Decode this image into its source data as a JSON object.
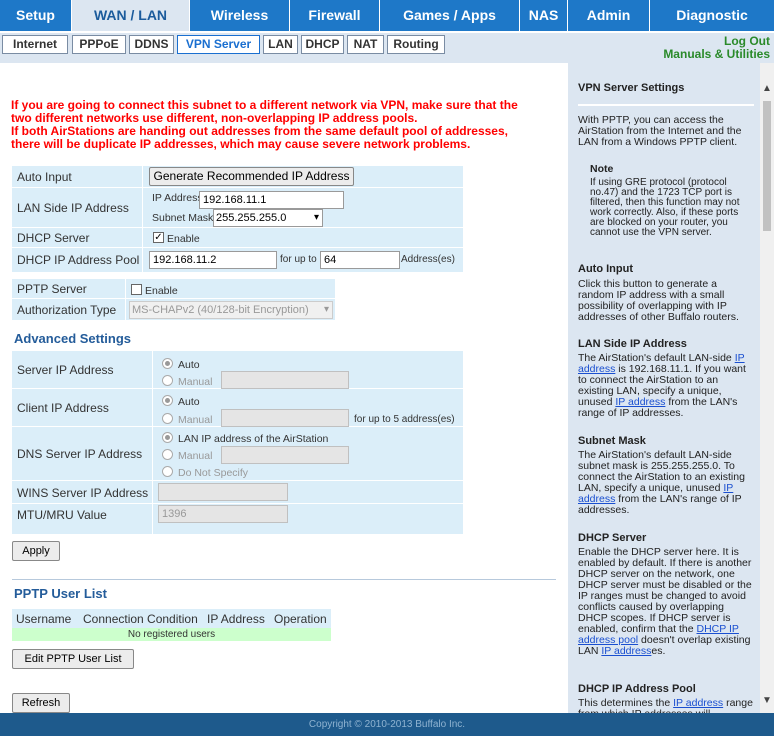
{
  "main_tabs": [
    "Setup",
    "WAN / LAN",
    "Wireless",
    "Firewall",
    "Games / Apps",
    "NAS",
    "Admin",
    "Diagnostic"
  ],
  "sub_tabs": [
    "Internet",
    "PPPoE",
    "DDNS",
    "VPN Server",
    "LAN",
    "DHCP",
    "NAT",
    "Routing"
  ],
  "right_links": {
    "logout": "Log Out",
    "manuals": "Manuals & Utilities"
  },
  "warning": {
    "line1": "If you are going to connect this subnet to a different network via VPN, make sure that the",
    "line2": "two different networks use different, non-overlapping IP address pools.",
    "line3": "If both AirStations are handing out addresses from the same default pool of addresses,",
    "line4": "there will be duplicate IP addresses, which may cause severe network problems."
  },
  "form": {
    "auto_input_label": "Auto Input",
    "generate_button": "Generate Recommended IP Address",
    "lan_ip_label": "LAN Side IP Address",
    "ip_address_label": "IP Address",
    "ip_address_value": "192.168.11.1",
    "subnet_mask_label": "Subnet Mask",
    "subnet_mask_value": "255.255.255.0",
    "dhcp_server_label": "DHCP Server",
    "enable_label": "Enable",
    "dhcp_pool_label": "DHCP IP Address Pool",
    "dhcp_pool_start": "192.168.11.2",
    "for_up_to": "for up to",
    "dhcp_pool_count": "64",
    "addresses_unit": "Address(es)"
  },
  "pptp": {
    "server_label": "PPTP Server",
    "enable_label": "Enable",
    "auth_label": "Authorization Type",
    "auth_value": "MS-CHAPv2 (40/128-bit Encryption)"
  },
  "advanced": {
    "heading": "Advanced Settings",
    "server_ip_label": "Server IP Address",
    "client_ip_label": "Client IP Address",
    "auto": "Auto",
    "manual": "Manual",
    "client_up_to": "for up to 5 address(es)",
    "dns_label": "DNS Server IP Address",
    "dns_lan_option": "LAN IP address of the AirStation",
    "dns_no_specify": "Do Not Specify",
    "wins_label": "WINS Server IP Address",
    "mtu_label": "MTU/MRU Value",
    "mtu_value": "1396"
  },
  "apply_button": "Apply",
  "user_list": {
    "heading": "PPTP User List",
    "columns": [
      "Username",
      "Connection Condition",
      "IP Address",
      "Operation"
    ],
    "empty_message": "No registered users",
    "edit_button": "Edit PPTP User List"
  },
  "refresh_button": "Refresh",
  "footer": "Copyright © 2010-2013 Buffalo Inc.",
  "help": {
    "title": "VPN Server Settings",
    "intro": "With PPTP, you can access the AirStation from the Internet and the LAN from a Windows PPTP client.",
    "note_heading": "Note",
    "note_text": "If using GRE protocol (protocol no.47) and the 1723 TCP port is filtered, then this function may not work correctly. Also, if these ports are blocked on your router, you cannot use the VPN server.",
    "auto_heading": "Auto Input",
    "auto_text": "Click this button to generate a random IP address with a small possibility of overlapping with IP addresses of other Buffalo routers.",
    "lan_heading": "LAN Side IP Address",
    "lan_text_1": "The AirStation's default LAN-side",
    "lan_link_1": "IP address",
    "lan_text_2": "is 192.168.11.1. If you want to connect the AirStation to an existing LAN, specify a unique, unused",
    "lan_link_2": "IP address",
    "lan_text_3": "from the LAN's range of IP addresses.",
    "subnet_heading": "Subnet Mask",
    "subnet_text_1": "The AirStation's default LAN-side subnet mask is 255.255.255.0. To connect the AirStation to an existing LAN, specify a unique, unused",
    "subnet_link": "IP address",
    "subnet_text_2": "from the LAN's range of IP addresses.",
    "dhcp_heading": "DHCP Server",
    "dhcp_text_1": "Enable the DHCP server here. It is enabled by default. If there is another DHCP server on the network, one DHCP server must be disabled or the IP ranges must be changed to avoid conflicts caused by overlapping DHCP scopes. If DHCP server is enabled, confirm that the",
    "dhcp_link_1": "DHCP IP address pool",
    "dhcp_text_2": "doesn't overlap existing LAN",
    "dhcp_link_2": "IP address",
    "dhcp_text_3": "es.",
    "pool_heading": "DHCP IP Address Pool",
    "pool_text_1": "This determines the",
    "pool_link": "IP address",
    "pool_text_2": "range from which IP addresses will"
  },
  "colors": {
    "tab_blue": "#1e78c8",
    "subnav_bg": "#dce6f1",
    "form_bg": "#dbeef9",
    "warning": "#ff0000",
    "section_heading": "#245c9a",
    "empty_row": "#ccffcc",
    "footer_bg": "#1e5a8c"
  }
}
